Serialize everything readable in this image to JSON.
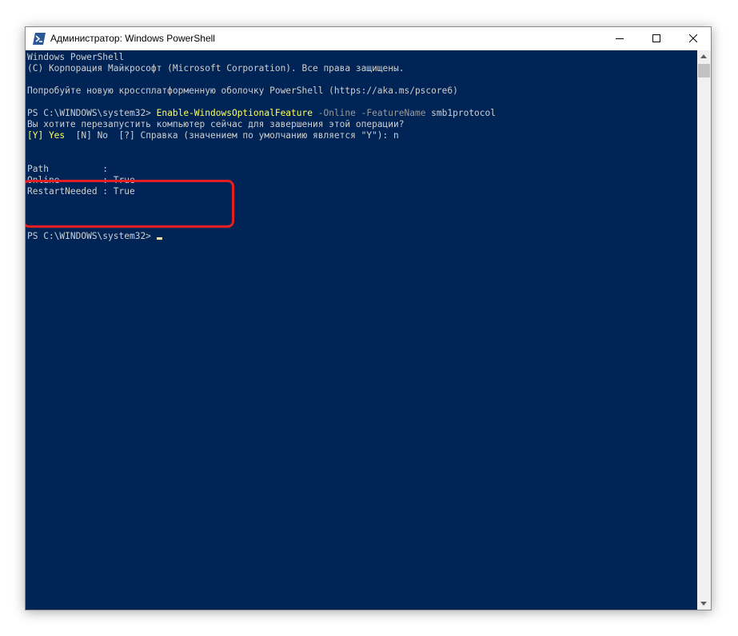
{
  "window": {
    "title": "Администратор: Windows PowerShell",
    "icon": "powershell-icon",
    "controls": [
      "minimize-icon",
      "maximize-icon",
      "close-icon"
    ]
  },
  "console": {
    "banner_line1": "Windows PowerShell",
    "banner_line2": "(С) Корпорация Майкрософт (Microsoft Corporation). Все права защищены.",
    "banner_line3": "Попробуйте новую кроссплатформенную оболочку PowerShell (https://aka.ms/pscore6)",
    "prompt1": "PS C:\\WINDOWS\\system32> ",
    "command_name": "Enable-WindowsOptionalFeature",
    "param_online": " -Online",
    "param_featurename": " -FeatureName",
    "feature_value": " smb1protocol",
    "question": "Вы хотите перезапустить компьютер сейчас для завершения этой операции?",
    "choice_yes": "[Y] Yes",
    "choice_rest": "  [N] No  [?] Справка (значением по умолчанию является \"Y\"): n",
    "result_path": "Path          :",
    "result_online": "Online        : True",
    "result_restart": "RestartNeeded : True",
    "prompt2": "PS C:\\WINDOWS\\system32> "
  },
  "colors": {
    "console_background": "#012456",
    "command_color": "#ffff55",
    "parameter_color": "#9a9a9a",
    "text_color": "#cfcfcf",
    "highlight_border": "#e31e24"
  }
}
